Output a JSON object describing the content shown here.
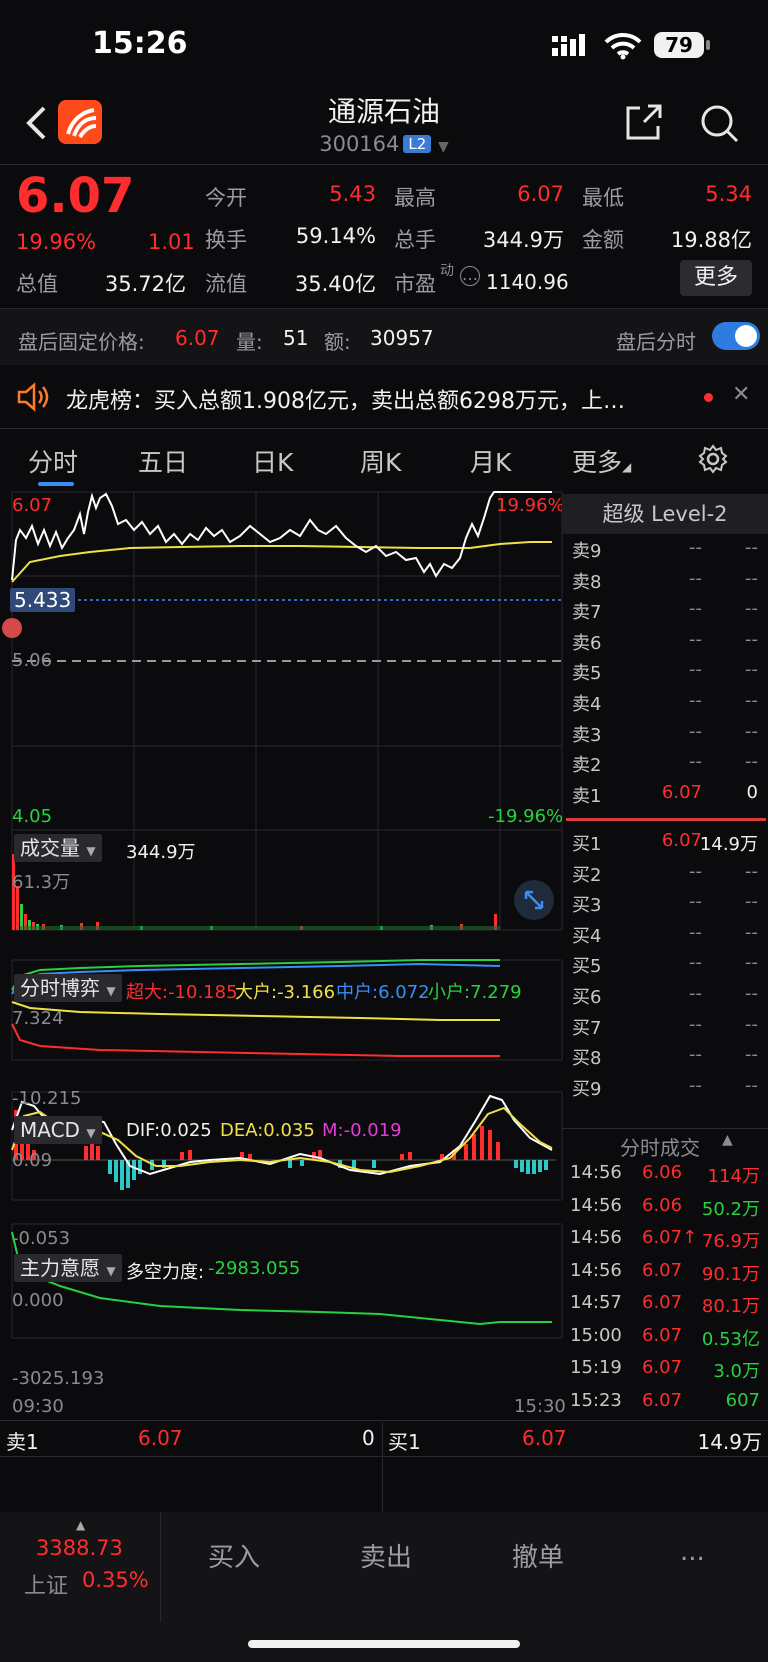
{
  "status_bar": {
    "time": "15:26",
    "battery": "79"
  },
  "header": {
    "name": "通源石油",
    "code": "300164",
    "level_badge": "L2"
  },
  "quote": {
    "price": "6.07",
    "change_pct": "19.96%",
    "change": "1.01",
    "open_label": "今开",
    "open": "5.43",
    "high_label": "最高",
    "high": "6.07",
    "low_label": "最低",
    "low": "5.34",
    "turnover_label": "换手",
    "turnover": "59.14%",
    "volume_label": "总手",
    "volume": "344.9万",
    "amount_label": "金额",
    "amount": "19.88亿",
    "mktcap_label": "总值",
    "mktcap": "35.72亿",
    "float_label": "流值",
    "float": "35.40亿",
    "pe_label": "市盈",
    "pe_sup": "动",
    "pe": "1140.96",
    "more_button": "更多"
  },
  "after_hours": {
    "label": "盘后固定价格:",
    "price": "6.07",
    "vol_label": "量:",
    "vol": "51",
    "amt_label": "额:",
    "amt": "30957",
    "toggle_label": "盘后分时",
    "toggle_on": true
  },
  "ticker": {
    "text": "龙虎榜：买入总额1.908亿元，卖出总额6298万元，上…"
  },
  "tabs": [
    "分时",
    "五日",
    "日K",
    "周K",
    "月K",
    "更多"
  ],
  "intraday": {
    "price_high": "6.07",
    "pct_high": "19.96%",
    "price_low": "4.05",
    "pct_low": "-19.96%",
    "cursor_price": "5.433",
    "prev_close": "5.06",
    "time_start": "09:30",
    "time_end": "15:30"
  },
  "volume_panel": {
    "label": "成交量",
    "total": "344.9万",
    "max": "61.3万"
  },
  "fund_panel": {
    "label": "分时博弈",
    "super": "超大:-10.185",
    "large": "大户:-3.166",
    "mid": "中户:6.072",
    "small": "小户:7.279",
    "max": "7.324",
    "min": "-10.215"
  },
  "macd_panel": {
    "label": "MACD",
    "dif": "DIF:0.025",
    "dea": "DEA:0.035",
    "m": "M:-0.019",
    "max": "0.09",
    "min": "-0.053"
  },
  "main_panel": {
    "label": "主力意愿",
    "force_label": "多空力度:",
    "force": "-2983.055",
    "max": "0.000",
    "min": "-3025.193"
  },
  "orderbook": {
    "title": "超级 Level-2",
    "asks": [
      {
        "n": "卖9",
        "p": "--",
        "v": "--"
      },
      {
        "n": "卖8",
        "p": "--",
        "v": "--"
      },
      {
        "n": "卖7",
        "p": "--",
        "v": "--"
      },
      {
        "n": "卖6",
        "p": "--",
        "v": "--"
      },
      {
        "n": "卖5",
        "p": "--",
        "v": "--"
      },
      {
        "n": "卖4",
        "p": "--",
        "v": "--"
      },
      {
        "n": "卖3",
        "p": "--",
        "v": "--"
      },
      {
        "n": "卖2",
        "p": "--",
        "v": "--"
      },
      {
        "n": "卖1",
        "p": "6.07",
        "v": "0"
      }
    ],
    "bids": [
      {
        "n": "买1",
        "p": "6.07",
        "v": "14.9万"
      },
      {
        "n": "买2",
        "p": "--",
        "v": "--"
      },
      {
        "n": "买3",
        "p": "--",
        "v": "--"
      },
      {
        "n": "买4",
        "p": "--",
        "v": "--"
      },
      {
        "n": "买5",
        "p": "--",
        "v": "--"
      },
      {
        "n": "买6",
        "p": "--",
        "v": "--"
      },
      {
        "n": "买7",
        "p": "--",
        "v": "--"
      },
      {
        "n": "买8",
        "p": "--",
        "v": "--"
      },
      {
        "n": "买9",
        "p": "--",
        "v": "--"
      }
    ]
  },
  "trades": {
    "title": "分时成交",
    "rows": [
      {
        "t": "14:56",
        "p": "6.06",
        "v": "114万",
        "vc": "red"
      },
      {
        "t": "14:56",
        "p": "6.06",
        "v": "50.2万",
        "vc": "green"
      },
      {
        "t": "14:56",
        "p": "6.07↑",
        "v": "76.9万",
        "vc": "red"
      },
      {
        "t": "14:56",
        "p": "6.07",
        "v": "90.1万",
        "vc": "red"
      },
      {
        "t": "14:57",
        "p": "6.07",
        "v": "80.1万",
        "vc": "red"
      },
      {
        "t": "15:00",
        "p": "6.07",
        "v": "0.53亿",
        "vc": "green"
      },
      {
        "t": "15:19",
        "p": "6.07",
        "v": "3.0万",
        "vc": "green"
      },
      {
        "t": "15:23",
        "p": "6.07",
        "v": "607",
        "vc": "green"
      }
    ]
  },
  "best_bar": {
    "ask_label": "卖1",
    "ask_price": "6.07",
    "ask_vol": "0",
    "bid_label": "买1",
    "bid_price": "6.07",
    "bid_vol": "14.9万"
  },
  "index": {
    "value": "3388.73",
    "name": "上证",
    "pct": "0.35%"
  },
  "actions": {
    "buy": "买入",
    "sell": "卖出",
    "cancel": "撤单",
    "more": "..."
  }
}
